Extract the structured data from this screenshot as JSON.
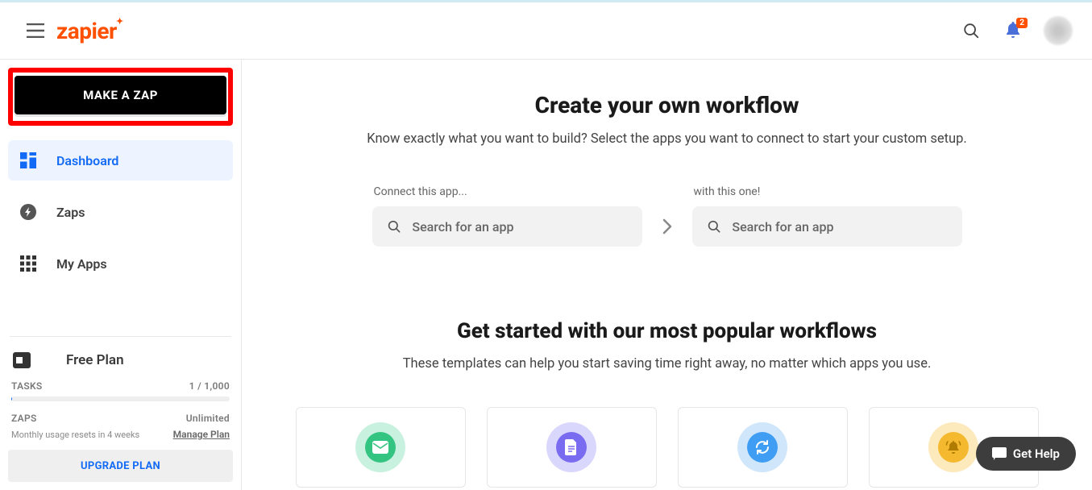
{
  "brand": {
    "name": "zapier"
  },
  "topbar": {
    "notif_count": "2"
  },
  "sidebar": {
    "make_zap": "MAKE A ZAP",
    "nav": {
      "dashboard": "Dashboard",
      "zaps": "Zaps",
      "myapps": "My Apps"
    },
    "plan": {
      "name": "Free Plan",
      "tasks_label": "TASKS",
      "tasks_value": "1 / 1,000",
      "zaps_label": "ZAPS",
      "zaps_value": "Unlimited",
      "reset_note": "Monthly usage resets in 4 weeks",
      "manage": "Manage Plan",
      "upgrade": "UPGRADE PLAN"
    }
  },
  "main": {
    "heading": "Create your own workflow",
    "subheading": "Know exactly what you want to build? Select the apps you want to connect to start your custom setup.",
    "connect": {
      "label_a": "Connect this app...",
      "label_b": "with this one!",
      "placeholder": "Search for an app"
    },
    "popular": {
      "heading": "Get started with our most popular workflows",
      "subheading": "These templates can help you start saving time right away, no matter which apps you use."
    }
  },
  "help": {
    "label": "Get Help"
  },
  "colors": {
    "card1_outer": "#c8f1df",
    "card1_inner": "#33c481",
    "card2_outer": "#d9d7fb",
    "card2_inner": "#7a6cf0",
    "card3_outer": "#cfe6fb",
    "card3_inner": "#3f9ef3",
    "card4_outer": "#fdeabc",
    "card4_inner": "#f4b92f"
  }
}
